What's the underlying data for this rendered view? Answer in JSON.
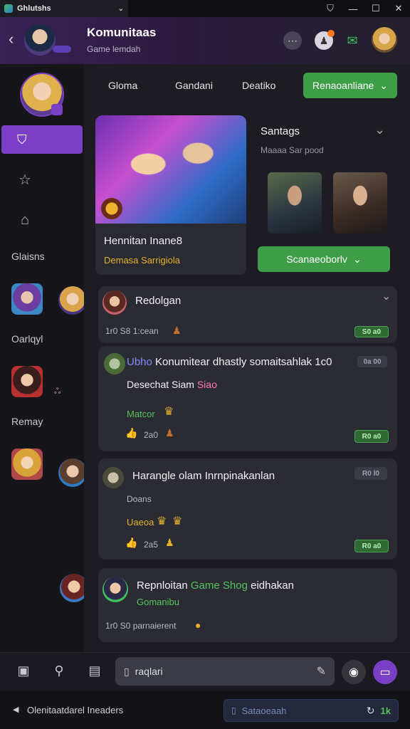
{
  "titlebar": {
    "tab_title": "Ghlutshs",
    "min": "—",
    "max": "☐",
    "close": "✕",
    "shield": "⛉"
  },
  "header": {
    "title": "Komunitaas",
    "subtitle": "Game lemdah"
  },
  "sidebar": {
    "labels": [
      "Glaisns",
      "Oarlqyl",
      "Remay"
    ]
  },
  "nav": {
    "tabs": [
      "Gloma",
      "Gandani",
      "Deatiko"
    ],
    "dropdown_label": "Renaoanliane"
  },
  "featured": {
    "title": "Hennitan Inane8",
    "subtitle": "Demasa Sarrigiola"
  },
  "side_panel": {
    "title": "Santags",
    "subtitle": "Maaaa Sar pood",
    "button": "Scanaeoborlv"
  },
  "posts": [
    {
      "title": "Redolgan",
      "meta": "1r0  S8  1:cean",
      "badge": "S0 a0"
    },
    {
      "prefix": "Ubho",
      "title": "Konumitear dhastly somaitsahlak 1c0",
      "badge_top": "0a 00",
      "line2": "Desechat Siam",
      "line2_pink": "Siao",
      "tag": "Matcor",
      "meta": "2a0",
      "badge": "R0 a0"
    },
    {
      "title": "Harangle olam Inrnpinakanlan",
      "badge_top": "R0 l0",
      "line2": "Doans",
      "tag": "Uaeoa",
      "meta": "2a5",
      "badge": "R0 a0"
    },
    {
      "title": "Repnloitan",
      "title_green": "Game Shog",
      "title_end": "eidhakan",
      "line2": "Gomanibu",
      "meta": "1r0  S0  parnaierent"
    }
  ],
  "composer": {
    "placeholder": "raqlari"
  },
  "status": {
    "left_text": "Olenitaatdarel Ineaders",
    "search": "Sataoeaah",
    "count": "1k"
  },
  "colors": {
    "accent_purple": "#7a3fc4",
    "accent_green": "#3e9e47",
    "bg": "#18181d"
  }
}
